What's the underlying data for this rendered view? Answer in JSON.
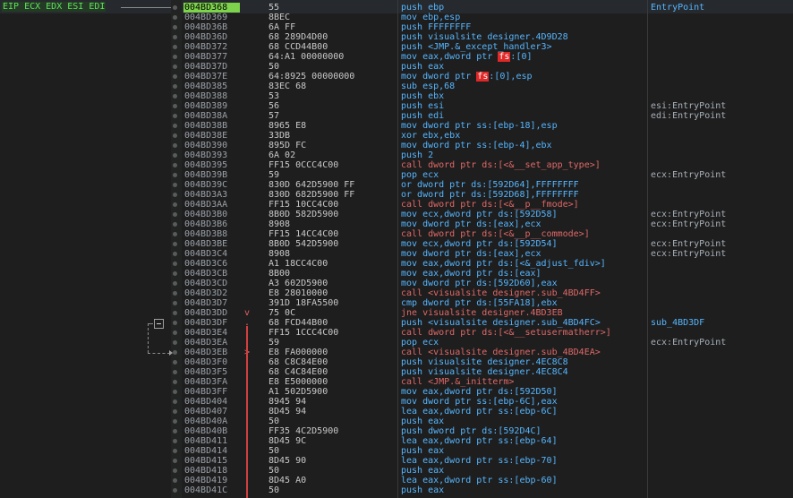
{
  "registers_label": "EIP ECX EDX ESI EDI",
  "rows": [
    {
      "addr": "004BD368",
      "bytes": "55",
      "instr": "push ebp",
      "comment": "EntryPoint",
      "kind": "normal",
      "selected": true,
      "comment_kind": "label"
    },
    {
      "addr": "004BD369",
      "bytes": "8BEC",
      "instr": "mov ebp,esp",
      "comment": "",
      "kind": "normal"
    },
    {
      "addr": "004BD36B",
      "bytes": "6A FF",
      "instr": "push FFFFFFFF",
      "comment": "",
      "kind": "normal"
    },
    {
      "addr": "004BD36D",
      "bytes": "68 289D4D00",
      "instr": "push visualsite designer.4D9D28",
      "comment": "",
      "kind": "normal"
    },
    {
      "addr": "004BD372",
      "bytes": "68 CCD44B00",
      "instr": "push <JMP.&_except_handler3>",
      "comment": "",
      "kind": "normal"
    },
    {
      "addr": "004BD377",
      "bytes": "64:A1 00000000",
      "instr": "mov eax,dword ptr |fs|:[0]",
      "comment": "",
      "kind": "normal"
    },
    {
      "addr": "004BD37D",
      "bytes": "50",
      "instr": "push eax",
      "comment": "",
      "kind": "normal"
    },
    {
      "addr": "004BD37E",
      "bytes": "64:8925 00000000",
      "instr": "mov dword ptr |fs|:[0],esp",
      "comment": "",
      "kind": "normal"
    },
    {
      "addr": "004BD385",
      "bytes": "83EC 68",
      "instr": "sub esp,68",
      "comment": "",
      "kind": "normal"
    },
    {
      "addr": "004BD388",
      "bytes": "53",
      "instr": "push ebx",
      "comment": "",
      "kind": "normal"
    },
    {
      "addr": "004BD389",
      "bytes": "56",
      "instr": "push esi",
      "comment": "esi:EntryPoint",
      "kind": "normal"
    },
    {
      "addr": "004BD38A",
      "bytes": "57",
      "instr": "push edi",
      "comment": "edi:EntryPoint",
      "kind": "normal"
    },
    {
      "addr": "004BD38B",
      "bytes": "8965 E8",
      "instr": "mov dword ptr ss:[ebp-18],esp",
      "comment": "",
      "kind": "normal"
    },
    {
      "addr": "004BD38E",
      "bytes": "33DB",
      "instr": "xor ebx,ebx",
      "comment": "",
      "kind": "normal"
    },
    {
      "addr": "004BD390",
      "bytes": "895D FC",
      "instr": "mov dword ptr ss:[ebp-4],ebx",
      "comment": "",
      "kind": "normal"
    },
    {
      "addr": "004BD393",
      "bytes": "6A 02",
      "instr": "push 2",
      "comment": "",
      "kind": "normal"
    },
    {
      "addr": "004BD395",
      "bytes": "FF15 0CCC4C00",
      "instr": "call dword ptr ds:[<&__set_app_type>]",
      "comment": "",
      "kind": "call"
    },
    {
      "addr": "004BD39B",
      "bytes": "59",
      "instr": "pop ecx",
      "comment": "ecx:EntryPoint",
      "kind": "normal"
    },
    {
      "addr": "004BD39C",
      "bytes": "830D 642D5900 FF",
      "instr": "or dword ptr ds:[592D64],FFFFFFFF",
      "comment": "",
      "kind": "normal"
    },
    {
      "addr": "004BD3A3",
      "bytes": "830D 682D5900 FF",
      "instr": "or dword ptr ds:[592D68],FFFFFFFF",
      "comment": "",
      "kind": "normal"
    },
    {
      "addr": "004BD3AA",
      "bytes": "FF15 10CC4C00",
      "instr": "call dword ptr ds:[<&__p__fmode>]",
      "comment": "",
      "kind": "call"
    },
    {
      "addr": "004BD3B0",
      "bytes": "8B0D 582D5900",
      "instr": "mov ecx,dword ptr ds:[592D58]",
      "comment": "ecx:EntryPoint",
      "kind": "normal"
    },
    {
      "addr": "004BD3B6",
      "bytes": "8908",
      "instr": "mov dword ptr ds:[eax],ecx",
      "comment": "ecx:EntryPoint",
      "kind": "normal"
    },
    {
      "addr": "004BD3B8",
      "bytes": "FF15 14CC4C00",
      "instr": "call dword ptr ds:[<&__p__commode>]",
      "comment": "",
      "kind": "call"
    },
    {
      "addr": "004BD3BE",
      "bytes": "8B0D 542D5900",
      "instr": "mov ecx,dword ptr ds:[592D54]",
      "comment": "ecx:EntryPoint",
      "kind": "normal"
    },
    {
      "addr": "004BD3C4",
      "bytes": "8908",
      "instr": "mov dword ptr ds:[eax],ecx",
      "comment": "ecx:EntryPoint",
      "kind": "normal"
    },
    {
      "addr": "004BD3C6",
      "bytes": "A1 18CC4C00",
      "instr": "mov eax,dword ptr ds:[<&_adjust_fdiv>]",
      "comment": "",
      "kind": "normal"
    },
    {
      "addr": "004BD3CB",
      "bytes": "8B00",
      "instr": "mov eax,dword ptr ds:[eax]",
      "comment": "",
      "kind": "normal"
    },
    {
      "addr": "004BD3CD",
      "bytes": "A3 602D5900",
      "instr": "mov dword ptr ds:[592D60],eax",
      "comment": "",
      "kind": "normal"
    },
    {
      "addr": "004BD3D2",
      "bytes": "E8 28010000",
      "instr": "call <visualsite designer.sub_4BD4FF>",
      "comment": "",
      "kind": "call"
    },
    {
      "addr": "004BD3D7",
      "bytes": "391D 18FA5500",
      "instr": "cmp dword ptr ds:[55FA18],ebx",
      "comment": "",
      "kind": "normal"
    },
    {
      "addr": "004BD3DD",
      "bytes": "75 0C",
      "instr": "jne visualsite designer.4BD3EB",
      "comment": "",
      "kind": "jcc",
      "marker": "v"
    },
    {
      "addr": "004BD3DF",
      "bytes": "68 FCD44B00",
      "instr": "push <visualsite designer.sub_4BD4FC>",
      "comment": "sub_4BD3DF",
      "kind": "normal",
      "marker": ".",
      "comment_kind": "label"
    },
    {
      "addr": "004BD3E4",
      "bytes": "FF15 1CCC4C00",
      "instr": "call dword ptr ds:[<&__setusermatherr>]",
      "comment": "",
      "kind": "call",
      "marker": "."
    },
    {
      "addr": "004BD3EA",
      "bytes": "59",
      "instr": "pop ecx",
      "comment": "ecx:EntryPoint",
      "kind": "normal",
      "marker": "."
    },
    {
      "addr": "004BD3EB",
      "bytes": "E8 FA000000",
      "instr": "call <visualsite designer.sub_4BD4EA>",
      "comment": "",
      "kind": "call",
      "marker": ">"
    },
    {
      "addr": "004BD3F0",
      "bytes": "68 C8C84E00",
      "instr": "push visualsite designer.4EC8C8",
      "comment": "",
      "kind": "normal",
      "marker": "."
    },
    {
      "addr": "004BD3F5",
      "bytes": "68 C4C84E00",
      "instr": "push visualsite designer.4EC8C4",
      "comment": "",
      "kind": "normal",
      "marker": "."
    },
    {
      "addr": "004BD3FA",
      "bytes": "E8 E5000000",
      "instr": "call <JMP.&_initterm>",
      "comment": "",
      "kind": "call",
      "marker": "."
    },
    {
      "addr": "004BD3FF",
      "bytes": "A1 502D5900",
      "instr": "mov eax,dword ptr ds:[592D50]",
      "comment": "",
      "kind": "normal",
      "marker": "."
    },
    {
      "addr": "004BD404",
      "bytes": "8945 94",
      "instr": "mov dword ptr ss:[ebp-6C],eax",
      "comment": "",
      "kind": "normal",
      "marker": "."
    },
    {
      "addr": "004BD407",
      "bytes": "8D45 94",
      "instr": "lea eax,dword ptr ss:[ebp-6C]",
      "comment": "",
      "kind": "normal",
      "marker": "."
    },
    {
      "addr": "004BD40A",
      "bytes": "50",
      "instr": "push eax",
      "comment": "",
      "kind": "normal",
      "marker": "."
    },
    {
      "addr": "004BD40B",
      "bytes": "FF35 4C2D5900",
      "instr": "push dword ptr ds:[592D4C]",
      "comment": "",
      "kind": "normal",
      "marker": "."
    },
    {
      "addr": "004BD411",
      "bytes": "8D45 9C",
      "instr": "lea eax,dword ptr ss:[ebp-64]",
      "comment": "",
      "kind": "normal",
      "marker": "."
    },
    {
      "addr": "004BD414",
      "bytes": "50",
      "instr": "push eax",
      "comment": "",
      "kind": "normal",
      "marker": "."
    },
    {
      "addr": "004BD415",
      "bytes": "8D45 90",
      "instr": "lea eax,dword ptr ss:[ebp-70]",
      "comment": "",
      "kind": "normal",
      "marker": "."
    },
    {
      "addr": "004BD418",
      "bytes": "50",
      "instr": "push eax",
      "comment": "",
      "kind": "normal",
      "marker": "."
    },
    {
      "addr": "004BD419",
      "bytes": "8D45 A0",
      "instr": "lea eax,dword ptr ss:[ebp-60]",
      "comment": "",
      "kind": "normal",
      "marker": "."
    },
    {
      "addr": "004BD41C",
      "bytes": "50",
      "instr": "push eax",
      "comment": "",
      "kind": "normal",
      "marker": "."
    }
  ]
}
